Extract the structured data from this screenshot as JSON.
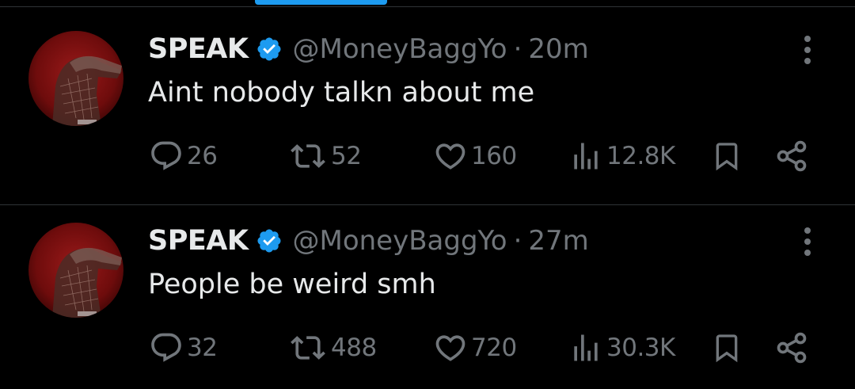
{
  "tweets": [
    {
      "display_name": "SPEAK",
      "handle": "@MoneyBaggYo",
      "separator": "·",
      "time": "20m",
      "text": "Aint nobody talkn about me",
      "replies": "26",
      "retweets": "52",
      "likes": "160",
      "views": "12.8K"
    },
    {
      "display_name": "SPEAK",
      "handle": "@MoneyBaggYo",
      "separator": "·",
      "time": "27m",
      "text": "People be weird smh",
      "replies": "32",
      "retweets": "488",
      "likes": "720",
      "views": "30.3K"
    }
  ],
  "colors": {
    "background": "#000000",
    "primary_text": "#e7e9ea",
    "secondary_text": "#71767b",
    "accent": "#1d9bf0",
    "divider": "#2f3336"
  },
  "icons": [
    "verified-badge-icon",
    "more-options-icon",
    "reply-icon",
    "retweet-icon",
    "like-icon",
    "views-icon",
    "bookmark-icon",
    "share-icon"
  ]
}
